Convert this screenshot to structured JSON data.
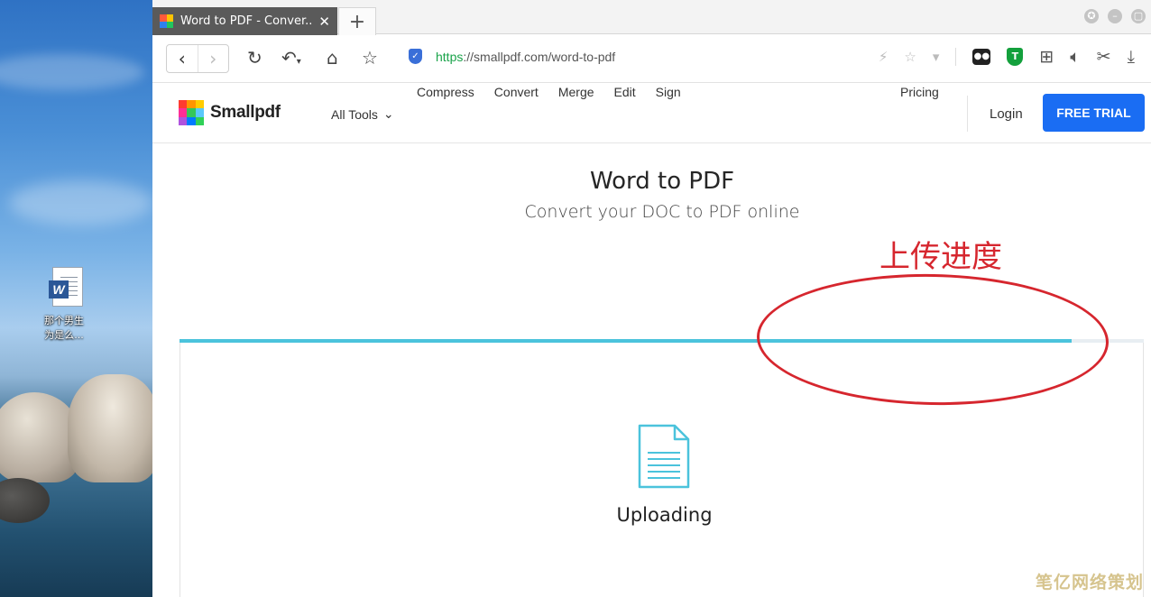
{
  "desktop": {
    "icon_label_line1": "那个男生",
    "icon_label_line2": "为是么..."
  },
  "tab": {
    "title": "Word to PDF - Conver...",
    "close_glyph": "✕",
    "new_tab_glyph": "+"
  },
  "window_controls": [
    "✪",
    "–",
    "▢"
  ],
  "address_bar": {
    "scheme": "https",
    "rest": "://smallpdf.com/word-to-pdf"
  },
  "site": {
    "brand": "Smallpdf",
    "all_tools": "All Tools",
    "menu": [
      "Compress",
      "Convert",
      "Merge",
      "Edit",
      "Sign"
    ],
    "pricing": "Pricing",
    "login": "Login",
    "free_trial": "FREE TRIAL"
  },
  "page": {
    "title": "Word to PDF",
    "subtitle": "Convert your DOC to PDF online",
    "status": "Uploading",
    "progress_percent": 92.5
  },
  "annotation": {
    "text": "上传进度",
    "color": "#d6262e"
  },
  "watermark": "笔亿网络策划",
  "colors": {
    "accent": "#1a6df3",
    "progress": "#4bc3dc"
  },
  "icons": [
    "back-icon",
    "forward-icon",
    "reload-icon",
    "undo-icon",
    "home-icon",
    "star-icon",
    "security-shield-icon",
    "lightning-icon",
    "ghost-extension-icon",
    "adblock-shield-icon",
    "apps-icon",
    "sound-icon",
    "scissors-icon",
    "download-icon",
    "chevron-down-icon",
    "document-icon"
  ]
}
